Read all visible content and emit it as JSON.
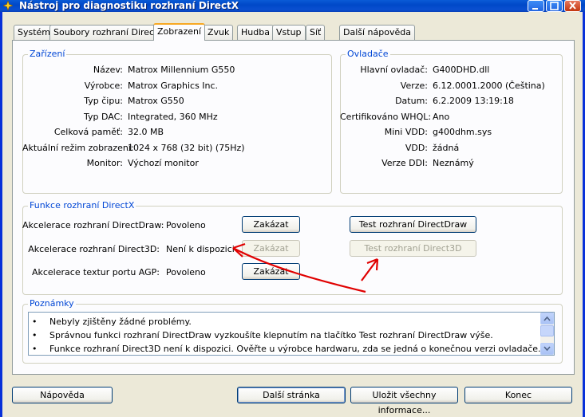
{
  "window": {
    "title": "Nástroj pro diagnostiku rozhraní DirectX"
  },
  "tabs": [
    {
      "label": "Systém"
    },
    {
      "label": "Soubory rozhraní DirectX"
    },
    {
      "label": "Zobrazení"
    },
    {
      "label": "Zvuk"
    },
    {
      "label": "Hudba"
    },
    {
      "label": "Vstup"
    },
    {
      "label": "Síť"
    },
    {
      "label": "Další nápověda"
    }
  ],
  "device": {
    "title": "Zařízení",
    "rows": [
      {
        "label": "Název:",
        "value": "Matrox Millennium G550"
      },
      {
        "label": "Výrobce:",
        "value": "Matrox Graphics Inc."
      },
      {
        "label": "Typ čipu:",
        "value": "Matrox G550"
      },
      {
        "label": "Typ DAC:",
        "value": "Integrated, 360 MHz"
      },
      {
        "label": "Celková paměť:",
        "value": "32.0 MB"
      },
      {
        "label": "Aktuální režim zobrazení:",
        "value": "1024 x 768 (32 bit) (75Hz)"
      },
      {
        "label": "Monitor:",
        "value": "Výchozí monitor"
      }
    ]
  },
  "drivers": {
    "title": "Ovladače",
    "rows": [
      {
        "label": "Hlavní ovladač:",
        "value": "G400DHD.dll"
      },
      {
        "label": "Verze:",
        "value": "6.12.0001.2000 (Čeština)"
      },
      {
        "label": "Datum:",
        "value": "6.2.2009 13:19:18"
      },
      {
        "label": "Certifikováno WHQL:",
        "value": "Ano"
      },
      {
        "label": "Mini VDD:",
        "value": "g400dhm.sys"
      },
      {
        "label": "VDD:",
        "value": "žádná"
      },
      {
        "label": "Verze DDI:",
        "value": "Neznámý"
      }
    ]
  },
  "features": {
    "title": "Funkce rozhraní DirectX",
    "rows": [
      {
        "label": "Akcelerace rozhraní DirectDraw:",
        "value": "Povoleno",
        "button": "Zakázat",
        "test": "Test rozhraní DirectDraw"
      },
      {
        "label": "Akcelerace rozhraní Direct3D:",
        "value": "Není k dispozici",
        "button": "Zakázat",
        "test": "Test rozhraní Direct3D"
      },
      {
        "label": "Akcelerace textur portu AGP:",
        "value": "Povoleno",
        "button": "Zakázat"
      }
    ]
  },
  "notes": {
    "title": "Poznámky",
    "bullet": "•",
    "items": [
      "Nebyly zjištěny žádné problémy.",
      "Správnou funkci rozhraní DirectDraw vyzkoušíte klepnutím na tlačítko Test rozhraní DirectDraw výše.",
      "Funkce rozhraní Direct3D není k dispozici. Ověřte u výrobce hardwaru, zda se jedná o konečnou verzi ovladače."
    ]
  },
  "footer": {
    "help": "Nápověda",
    "next_page": "Další stránka",
    "save_all": "Uložit všechny informace...",
    "exit": "Konec"
  },
  "colors": {
    "titlebar": "#0a5ad6",
    "group_title": "#0046d5",
    "annotation_arrows": "#e00000",
    "active_tab_accent": "#f7a823"
  }
}
